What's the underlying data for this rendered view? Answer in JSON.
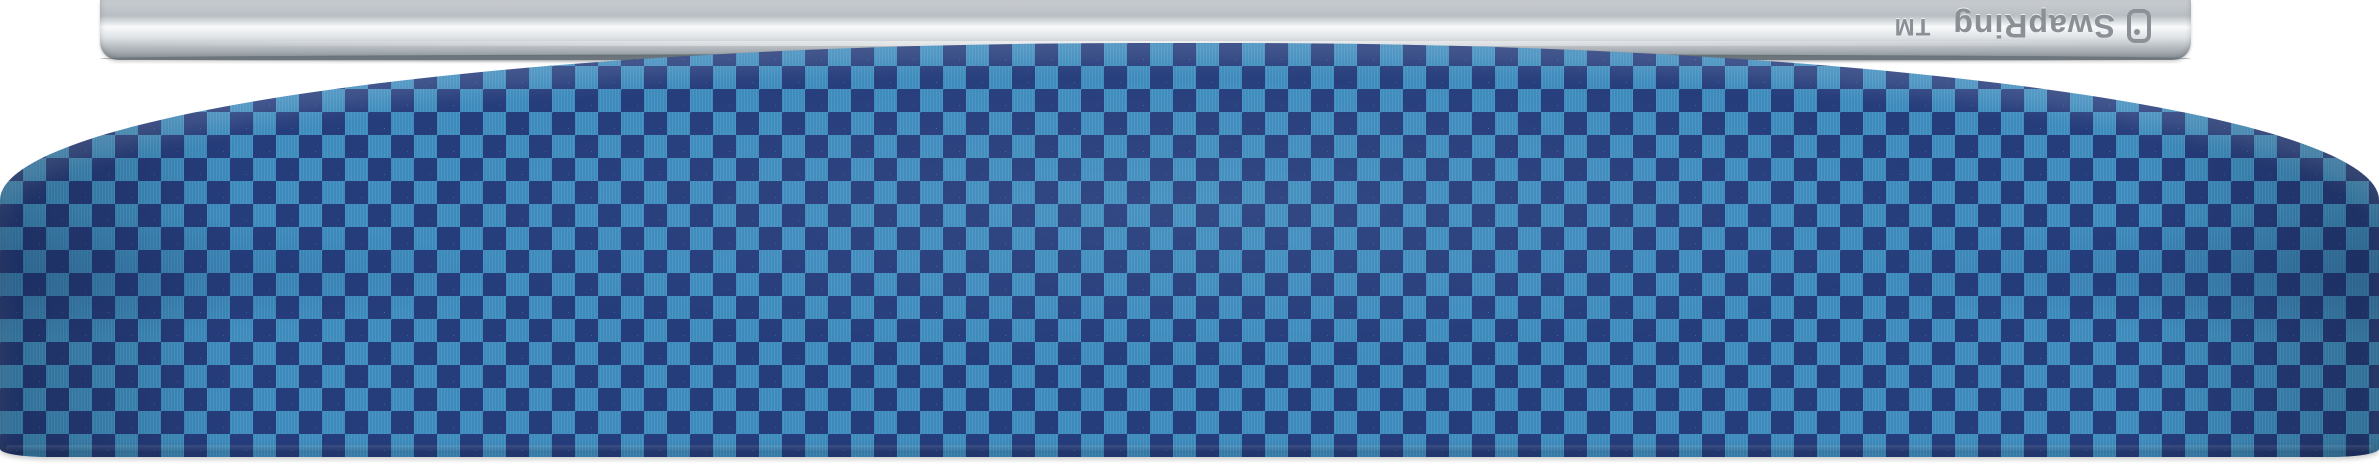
{
  "brand": {
    "name": "SwapRing",
    "trademark": "TM",
    "icon": "ring-logo-icon"
  },
  "product": {
    "pattern": "checkerboard",
    "colors": {
      "primary": "#3f8ec1",
      "secondary": "#263d7c",
      "metal": "#b8bec3"
    }
  }
}
